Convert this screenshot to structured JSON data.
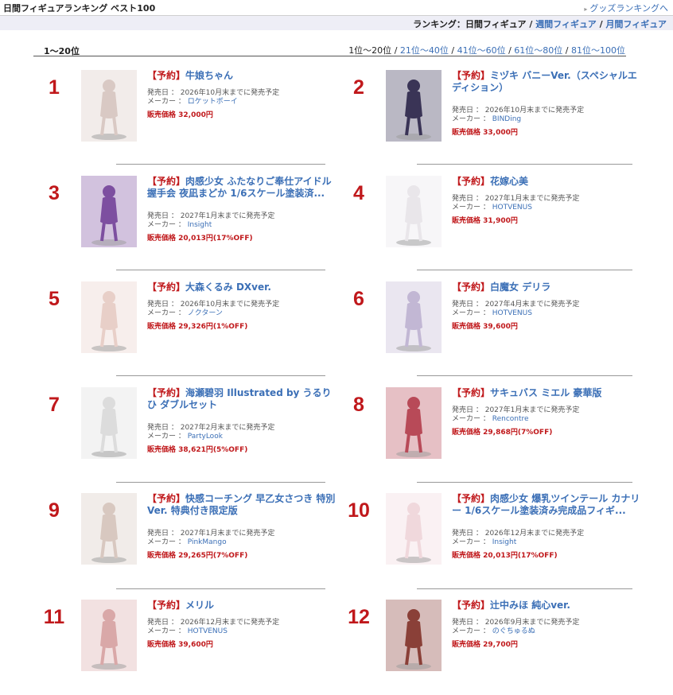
{
  "header": {
    "title": "日間フィギュアランキング ベスト100",
    "goods_link": "グッズランキングへ"
  },
  "ranking_nav": {
    "label": "ランキング：",
    "current": "日間フィギュア",
    "sep": " / ",
    "weekly": "週間フィギュア",
    "monthly": "月間フィギュア"
  },
  "range": {
    "label": "1〜20位",
    "current": "1位〜20位",
    "links": [
      "21位〜40位",
      "41位〜60位",
      "61位〜80位",
      "81位〜100位"
    ]
  },
  "labels": {
    "release": "発売日 ： ",
    "maker": "メーカー ： ",
    "price": "販売価格 ",
    "tag": "【予約】"
  },
  "items": [
    {
      "rank": "1",
      "name": "牛娘ちゃん",
      "release": "2026年10月末までに発売予定",
      "maker": "ロケットボーイ",
      "price": "32,000円",
      "color": "#d9c9c4"
    },
    {
      "rank": "2",
      "name": "ミヅキ バニーVer.（スペシャルエディション）",
      "release": "2026年10月末までに発売予定",
      "maker": "BINDing",
      "price": "33,000円",
      "color": "#3a3456"
    },
    {
      "rank": "3",
      "name": "肉感少女 ふたなりご奉仕アイドル 握手会 夜凪まどか 1/6スケール塗装済...",
      "release": "2027年1月末までに発売予定",
      "maker": "Insight",
      "price": "20,013円(17%OFF)",
      "color": "#7d4fa0"
    },
    {
      "rank": "4",
      "name": "花嫁心美",
      "release": "2027年1月末までに発売予定",
      "maker": "HOTVENUS",
      "price": "31,900円",
      "color": "#e9e6ea"
    },
    {
      "rank": "5",
      "name": "大森くるみ DXver.",
      "release": "2026年10月末までに発売予定",
      "maker": "ノクターン",
      "price": "29,326円(1%OFF)",
      "color": "#e8cfc8"
    },
    {
      "rank": "6",
      "name": "白魔女 デリラ",
      "release": "2027年4月末までに発売予定",
      "maker": "HOTVENUS",
      "price": "39,600円",
      "color": "#c2b7d4"
    },
    {
      "rank": "7",
      "name": "海瀬碧羽 Illustrated by うるりひ ダブルセット",
      "release": "2027年2月末までに発売予定",
      "maker": "PartyLook",
      "price": "38,621円(5%OFF)",
      "color": "#dcdcdc"
    },
    {
      "rank": "8",
      "name": "サキュバス ミエル 豪華版",
      "release": "2027年1月末までに発売予定",
      "maker": "Rencontre",
      "price": "29,868円(7%OFF)",
      "color": "#b84a58"
    },
    {
      "rank": "9",
      "name": "快感コーチング 早乙女さつき 特別 Ver. 特典付き限定版",
      "release": "2027年1月末までに発売予定",
      "maker": "PinkMango",
      "price": "29,265円(7%OFF)",
      "color": "#d8c8c0"
    },
    {
      "rank": "10",
      "name": "肉感少女 爆乳ツインテール カナリー 1/6スケール塗装済み完成品フィギ...",
      "release": "2026年12月末までに発売予定",
      "maker": "Insight",
      "price": "20,013円(17%OFF)",
      "color": "#f0d8dc"
    },
    {
      "rank": "11",
      "name": "メリル",
      "release": "2026年12月末までに発売予定",
      "maker": "HOTVENUS",
      "price": "39,600円",
      "color": "#d9a8a8"
    },
    {
      "rank": "12",
      "name": "辻中みほ 純心ver.",
      "release": "2026年9月末までに発売予定",
      "maker": "のぐちゅるぬ",
      "price": "29,700円",
      "color": "#8a4038"
    }
  ]
}
